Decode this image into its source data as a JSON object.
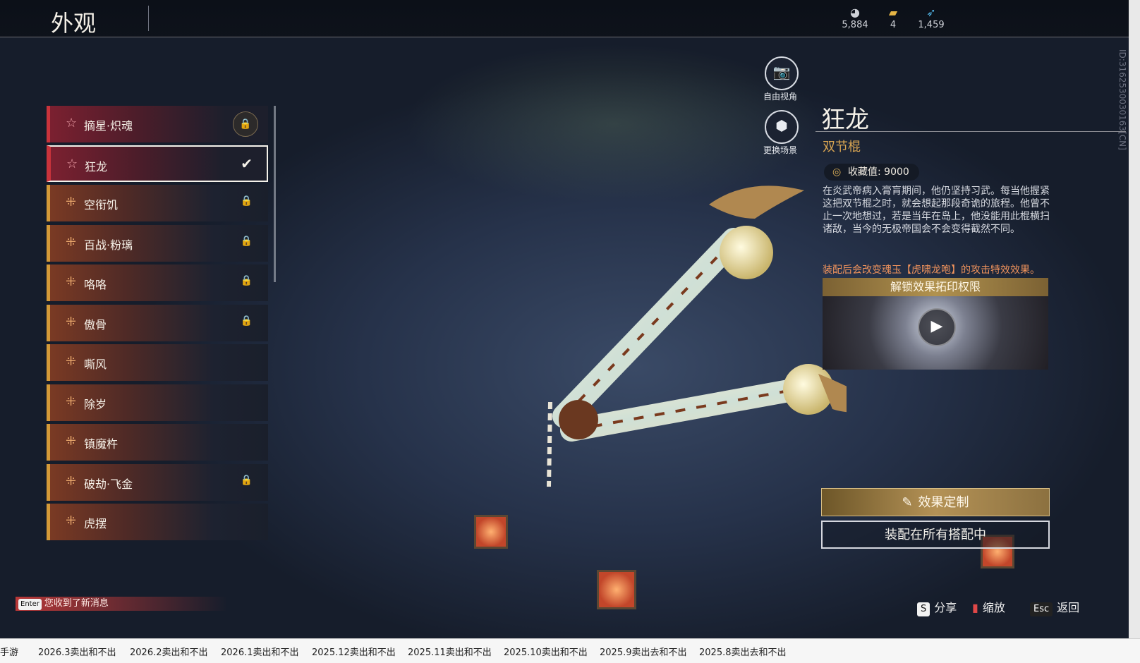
{
  "header": {
    "title": "外观",
    "currencies": [
      {
        "icon": "moon-coin-icon",
        "value": "5,884"
      },
      {
        "icon": "ticket-icon",
        "value": "4"
      },
      {
        "icon": "feather-icon",
        "value": "1,459"
      }
    ],
    "id_text": "ID:3162530030163[CN]"
  },
  "list": {
    "items": [
      {
        "label": "摘星·炽魂",
        "state": "locked"
      },
      {
        "label": "狂龙",
        "state": "selected"
      },
      {
        "label": "空衔饥",
        "state": "locked"
      },
      {
        "label": "百战·粉璃",
        "state": "locked"
      },
      {
        "label": "咯咯",
        "state": "locked"
      },
      {
        "label": "傲骨",
        "state": "locked"
      },
      {
        "label": "嘶风",
        "state": ""
      },
      {
        "label": "除岁",
        "state": ""
      },
      {
        "label": "镇魔杵",
        "state": ""
      },
      {
        "label": "破劫·飞金",
        "state": "locked"
      },
      {
        "label": "虎摆",
        "state": ""
      }
    ]
  },
  "camera": {
    "free_view": "自由视角",
    "change_scene": "更换场景"
  },
  "detail": {
    "name": "狂龙",
    "type": "双节棍",
    "collection_label": "收藏值: 9000",
    "description": "在炎武帝病入膏肓期间，他仍坚持习武。每当他握紧这把双节棍之时，就会想起那段奇诡的旅程。他曾不止一次地想过，若是当年在岛上，他没能用此棍横扫诸敌，当今的无极帝国会不会变得截然不同。",
    "note": "装配后会改变魂玉【虎啸龙咆】的攻击特效效果。",
    "unlock_title": "解锁效果拓印权限",
    "effect_button": "效果定制",
    "equip_button": "装配在所有搭配中"
  },
  "hints": {
    "message_key": "Enter",
    "message": "您收到了新消息",
    "share_key": "S",
    "share": "分享",
    "zoom": "缩放",
    "back_key": "Esc",
    "back": "返回"
  },
  "taskbar": {
    "tabs": [
      "手游",
      "2026.3卖出和不出",
      "2026.2卖出和不出",
      "2026.1卖出和不出",
      "2025.12卖出和不出",
      "2025.11卖出和不出",
      "2025.10卖出和不出",
      "2025.9卖出去和不出",
      "2025.8卖出去和不出"
    ]
  }
}
